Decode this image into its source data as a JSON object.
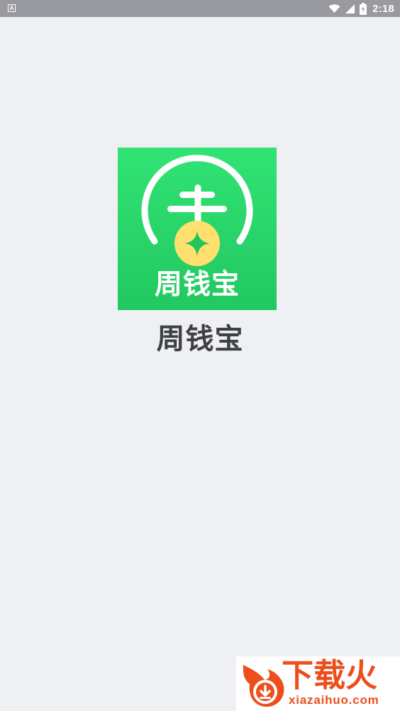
{
  "status_bar": {
    "left_indicator": "A",
    "time": "2:18",
    "icons": [
      "wifi-icon",
      "signal-icon",
      "battery-charging-icon"
    ]
  },
  "splash": {
    "logo_text": "周钱宝",
    "app_name": "周钱宝",
    "colors": {
      "background": "#eff0f4",
      "logo_green": "#27d366",
      "coin_yellow": "#ffdf6e",
      "title_text": "#3f4044"
    }
  },
  "watermark": {
    "title": "下载火",
    "url": "xiazaihuo.com",
    "colors": {
      "accent": "#ec4e1c"
    }
  }
}
